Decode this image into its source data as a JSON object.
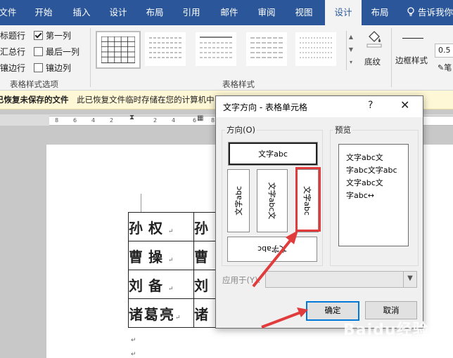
{
  "tabs": [
    {
      "label": "文件",
      "active": false
    },
    {
      "label": "开始",
      "active": false
    },
    {
      "label": "插入",
      "active": false
    },
    {
      "label": "设计",
      "active": false
    },
    {
      "label": "布局",
      "active": false
    },
    {
      "label": "引用",
      "active": false
    },
    {
      "label": "邮件",
      "active": false
    },
    {
      "label": "审阅",
      "active": false
    },
    {
      "label": "视图",
      "active": false
    },
    {
      "label": "设计",
      "active": true
    },
    {
      "label": "布局",
      "active": false
    }
  ],
  "tell_me": "告诉我你",
  "ribbon": {
    "options": [
      {
        "label": "标题行",
        "checked": true
      },
      {
        "label": "第一列",
        "checked": true
      },
      {
        "label": "汇总行",
        "checked": false
      },
      {
        "label": "最后一列",
        "checked": false
      },
      {
        "label": "镶边行",
        "checked": true
      },
      {
        "label": "镶边列",
        "checked": false
      }
    ],
    "options_group_label": "表格样式选项",
    "styles_group_label": "表格样式",
    "shading_label": "底纹",
    "border_styles_label": "边框样式",
    "border_width": "0.5",
    "pen_label": "笔"
  },
  "infobar": {
    "title": "已恢复未保存的文件",
    "message": "此已恢复文件临时存储在您的计算机中"
  },
  "ruler": {
    "numbers": [
      "8",
      "6",
      "4",
      "2",
      "",
      "2",
      "4",
      "6",
      "8"
    ]
  },
  "document": {
    "rows": [
      "孙权",
      "曹操",
      "刘备",
      "诸葛亮"
    ],
    "second_col": [
      "孙",
      "曹",
      "刘",
      "诸"
    ],
    "return_mark": "↵"
  },
  "dialog": {
    "title": "文字方向 - 表格单元格",
    "help": "?",
    "close": "✕",
    "orientation_label": "方向(O)",
    "preview_label": "预览",
    "options": [
      {
        "text": "文字abc",
        "mode": "horizontal",
        "selected": true
      },
      {
        "text": "文字abc",
        "mode": "rotate-left"
      },
      {
        "text": "文字abc文",
        "mode": "stacked"
      },
      {
        "text": "文字abc",
        "mode": "rotate-right"
      },
      {
        "text": "文字abc",
        "mode": "upside-down"
      }
    ],
    "preview_lines": [
      "文字abc文",
      "字abc文字abc",
      "文字abc文",
      "字abc↔"
    ],
    "apply_label": "应用于(Y):",
    "apply_value": "",
    "ok_label": "确定",
    "cancel_label": "取消"
  },
  "colors": {
    "ribbon_blue": "#2b579a",
    "annotation_red": "#e03c3c"
  },
  "watermark": "Baidu经验"
}
